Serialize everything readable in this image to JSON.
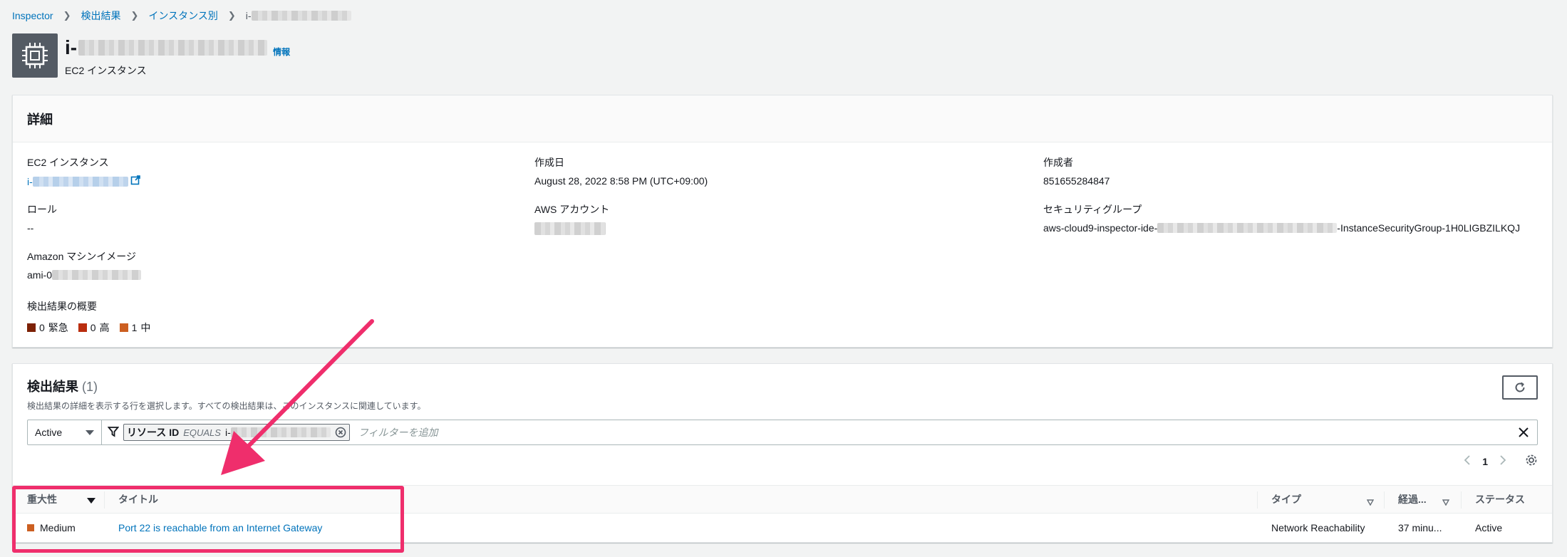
{
  "breadcrumb": {
    "items": [
      "Inspector",
      "検出結果",
      "インスタンス別"
    ],
    "current_prefix": "i-"
  },
  "header": {
    "instance_id_prefix": "i-",
    "info_link": "情報",
    "subtitle": "EC2 インスタンス"
  },
  "details": {
    "title": "詳細",
    "ec2_instance_label": "EC2 インスタンス",
    "ec2_instance_value_prefix": "i-",
    "role_label": "ロール",
    "role_value": "--",
    "ami_label": "Amazon マシンイメージ",
    "ami_value_prefix": "ami-0",
    "created_label": "作成日",
    "created_value": "August 28, 2022 8:58 PM (UTC+09:00)",
    "account_label": "AWS アカウント",
    "creator_label": "作成者",
    "creator_value": "851655284847",
    "sg_label": "セキュリティグループ",
    "sg_value_prefix": "aws-cloud9-inspector-ide-",
    "sg_value_suffix": "-InstanceSecurityGroup-1H0LIGBZILKQJ",
    "summary_label": "検出結果の概要",
    "severity_summary": [
      {
        "count": "0",
        "label": "緊急",
        "color": "#7d2105"
      },
      {
        "count": "0",
        "label": "高",
        "color": "#ba2e0f"
      },
      {
        "count": "1",
        "label": "中",
        "color": "#cc5f21"
      }
    ]
  },
  "findings": {
    "title": "検出結果",
    "count": "(1)",
    "description": "検出結果の詳細を表示する行を選択します。すべての検出結果は、このインスタンスに関連しています。",
    "status_select": "Active",
    "filter_token_key": "リソース ID",
    "filter_token_op": "EQUALS",
    "filter_token_value_prefix": "i-",
    "filter_placeholder": "フィルターを追加",
    "page_number": "1",
    "columns": {
      "severity": "重大性",
      "title": "タイトル",
      "type": "タイプ",
      "elapsed": "経過...",
      "status": "ステータス"
    },
    "rows": [
      {
        "severity": "Medium",
        "severity_color": "#cc5f21",
        "title": "Port 22 is reachable from an Internet Gateway",
        "type": "Network Reachability",
        "elapsed": "37 minu...",
        "status": "Active"
      }
    ]
  },
  "colors": {
    "link": "#0073bb",
    "annotation": "#ef2e6c",
    "background": "#f2f3f3"
  }
}
